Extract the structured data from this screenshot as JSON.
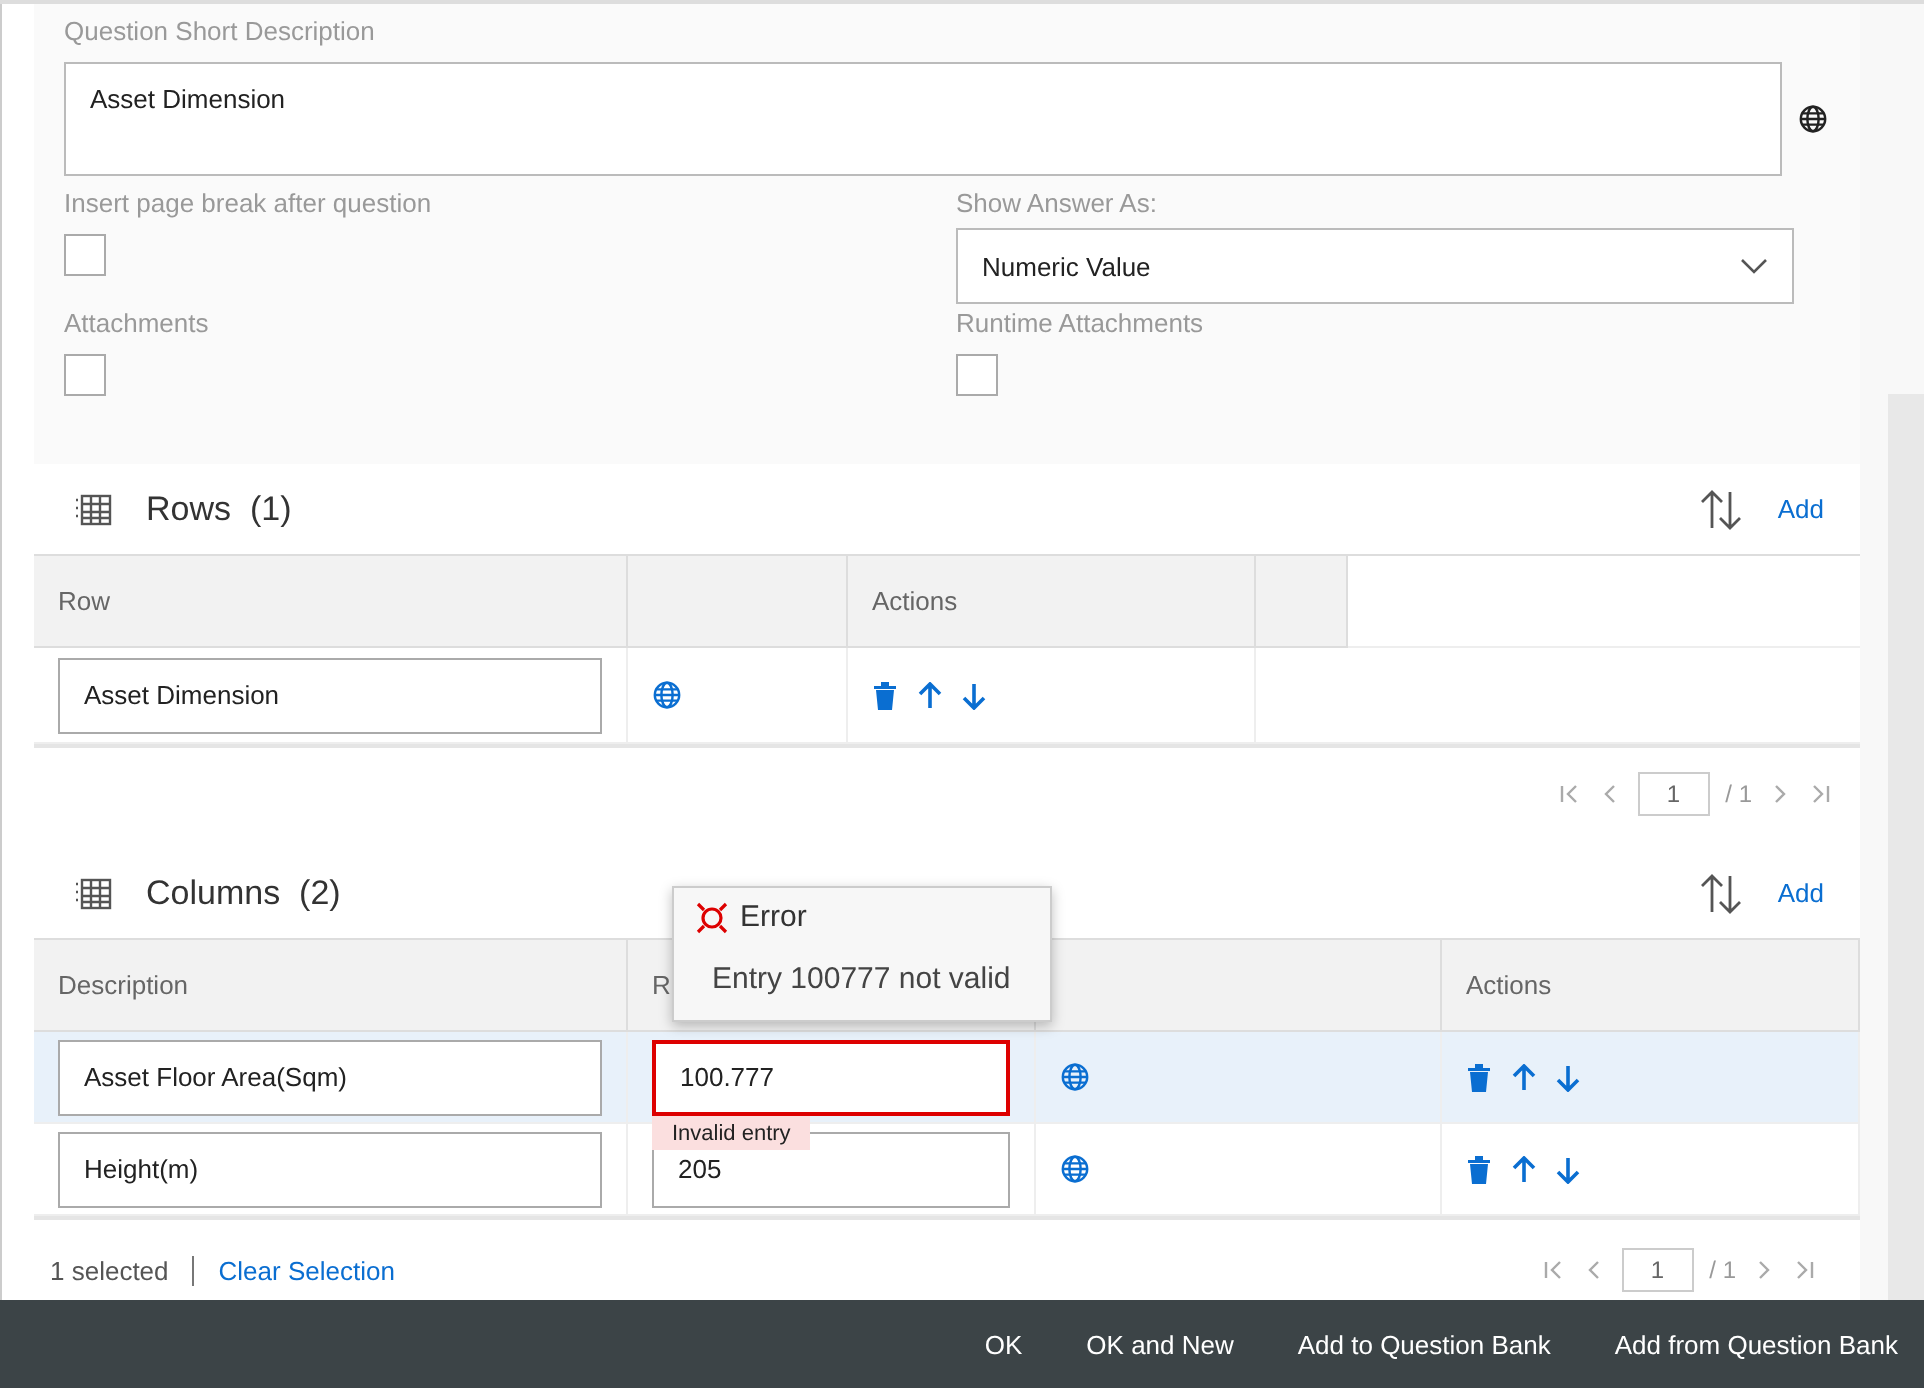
{
  "question": {
    "label": "Question Short Description",
    "value": "Asset Dimension"
  },
  "options": [
    {
      "kind": "checkbox",
      "label": "Insert page break after question",
      "checked": false
    },
    {
      "kind": "select",
      "label": "Show Answer As:",
      "value": "Numeric Value"
    },
    {
      "kind": "checkbox",
      "label": "Attachments",
      "checked": false
    },
    {
      "kind": "checkbox",
      "label": "Runtime Attachments",
      "checked": false
    }
  ],
  "rows_table": {
    "title": "Rows",
    "count": "(1)",
    "add": "Add",
    "columns": [
      "Row",
      "",
      "Actions",
      ""
    ],
    "rows": [
      {
        "description": "Asset Dimension",
        "selected": false
      }
    ],
    "pager": {
      "page": "1",
      "total": "/ 1"
    }
  },
  "columns_table": {
    "title": "Columns",
    "count": "(2)",
    "add": "Add",
    "columns": [
      "Description",
      "R",
      "",
      "Actions"
    ],
    "rows": [
      {
        "description": "Asset Floor Area(Sqm)",
        "value": "100.777",
        "error": true,
        "error_text": "Invalid entry",
        "selected": true
      },
      {
        "description": "Height(m)",
        "value": "205",
        "error": false,
        "selected": false
      }
    ],
    "pager": {
      "page": "1",
      "total": "/ 1"
    },
    "selection": {
      "count": "1 selected",
      "clear": "Clear Selection"
    },
    "popover": {
      "title": "Error",
      "message": "Entry 100777 not valid"
    }
  },
  "footer": {
    "buttons": [
      "OK",
      "OK and New",
      "Add to Question Bank",
      "Add from Question Bank"
    ]
  }
}
